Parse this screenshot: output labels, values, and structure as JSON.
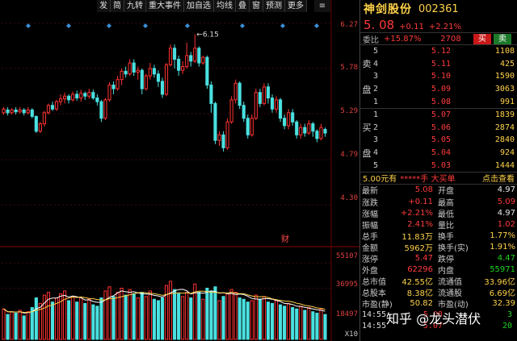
{
  "toolbar": {
    "items": [
      "发",
      "简",
      "九转",
      "重大事件",
      "加自选",
      "均线",
      "叠",
      "窗",
      "预测",
      "更多"
    ],
    "icon_left": "gear-icon",
    "menu_label": "≡"
  },
  "chart": {
    "price_labels": [
      "6.27",
      "5.78",
      "5.29",
      "4.79",
      "4.30"
    ],
    "peak_label": "6.15",
    "peak_marker": "←",
    "finance_badge": "财",
    "volume_labels": [
      "55107",
      "36995",
      "18497"
    ],
    "volume_unit": "X10"
  },
  "chart_data": {
    "type": "candlestick",
    "price_axis_ticks": [
      6.27,
      5.78,
      5.29,
      4.79,
      4.3
    ],
    "price_range": [
      3.9,
      6.4
    ],
    "volume_axis_ticks": [
      55107,
      36995,
      18497
    ],
    "volume_range": [
      0,
      60000
    ],
    "annotation_high": 6.15,
    "candles": [
      [
        5.3,
        5.34,
        5.28,
        5.36
      ],
      [
        5.33,
        5.3,
        5.27,
        5.36
      ],
      [
        5.3,
        5.33,
        5.28,
        5.35
      ],
      [
        5.33,
        5.31,
        5.28,
        5.36
      ],
      [
        5.31,
        5.33,
        5.29,
        5.36
      ],
      [
        5.33,
        5.3,
        5.27,
        5.35
      ],
      [
        5.3,
        5.33,
        5.28,
        5.36
      ],
      [
        5.33,
        5.26,
        5.24,
        5.35
      ],
      [
        5.26,
        5.1,
        5.08,
        5.27
      ],
      [
        5.1,
        5.18,
        5.08,
        5.2
      ],
      [
        5.18,
        5.3,
        5.15,
        5.32
      ],
      [
        5.3,
        5.38,
        5.28,
        5.4
      ],
      [
        5.38,
        5.34,
        5.32,
        5.42
      ],
      [
        5.34,
        5.42,
        5.32,
        5.44
      ],
      [
        5.42,
        5.45,
        5.38,
        5.5
      ],
      [
        5.45,
        5.48,
        5.4,
        5.52
      ],
      [
        5.48,
        5.44,
        5.4,
        5.5
      ],
      [
        5.44,
        5.5,
        5.42,
        5.53
      ],
      [
        5.5,
        5.46,
        5.43,
        5.54
      ],
      [
        5.46,
        5.51,
        5.42,
        5.55
      ],
      [
        5.51,
        5.48,
        5.44,
        5.53
      ],
      [
        5.48,
        5.52,
        5.45,
        5.56
      ],
      [
        5.52,
        5.46,
        5.44,
        5.55
      ],
      [
        5.46,
        5.42,
        5.38,
        5.5
      ],
      [
        5.42,
        5.24,
        5.2,
        5.44
      ],
      [
        5.24,
        5.44,
        5.22,
        5.46
      ],
      [
        5.44,
        5.6,
        5.42,
        5.63
      ],
      [
        5.6,
        5.56,
        5.5,
        5.64
      ],
      [
        5.56,
        5.66,
        5.54,
        5.7
      ],
      [
        5.66,
        5.75,
        5.6,
        5.78
      ],
      [
        5.75,
        5.72,
        5.68,
        5.8
      ],
      [
        5.72,
        5.84,
        5.7,
        5.88
      ],
      [
        5.84,
        5.74,
        5.7,
        5.88
      ],
      [
        5.74,
        5.76,
        5.66,
        5.8
      ],
      [
        5.76,
        5.56,
        5.5,
        5.78
      ],
      [
        5.56,
        5.7,
        5.54,
        5.72
      ],
      [
        5.7,
        5.78,
        5.66,
        5.84
      ],
      [
        5.78,
        5.72,
        5.68,
        5.82
      ],
      [
        5.72,
        5.64,
        5.58,
        5.76
      ],
      [
        5.64,
        5.5,
        5.46,
        5.68
      ],
      [
        5.5,
        5.82,
        5.48,
        5.84
      ],
      [
        5.82,
        6.0,
        5.8,
        6.04
      ],
      [
        6.0,
        5.88,
        5.78,
        6.04
      ],
      [
        5.88,
        5.76,
        5.7,
        5.92
      ],
      [
        5.76,
        5.8,
        5.72,
        5.86
      ],
      [
        5.8,
        5.92,
        5.78,
        6.06
      ],
      [
        5.92,
        5.86,
        5.8,
        5.96
      ],
      [
        5.86,
        6.0,
        5.84,
        6.15
      ],
      [
        6.0,
        5.84,
        5.8,
        6.02
      ],
      [
        5.84,
        5.9,
        5.82,
        5.92
      ],
      [
        5.9,
        5.6,
        5.56,
        5.92
      ],
      [
        5.6,
        5.4,
        5.3,
        5.64
      ],
      [
        5.4,
        5.0,
        4.96,
        5.42
      ],
      [
        5.0,
        5.06,
        4.94,
        5.1
      ],
      [
        5.06,
        4.92,
        4.88,
        5.1
      ],
      [
        4.92,
        5.2,
        4.9,
        5.24
      ],
      [
        5.2,
        5.44,
        5.18,
        5.48
      ],
      [
        5.44,
        5.62,
        5.4,
        5.66
      ],
      [
        5.62,
        5.38,
        5.34,
        5.64
      ],
      [
        5.38,
        5.24,
        5.2,
        5.42
      ],
      [
        5.24,
        5.06,
        5.02,
        5.28
      ],
      [
        5.06,
        5.24,
        5.04,
        5.28
      ],
      [
        5.24,
        5.52,
        5.22,
        5.56
      ],
      [
        5.52,
        5.4,
        5.36,
        5.56
      ],
      [
        5.4,
        5.58,
        5.38,
        5.62
      ],
      [
        5.58,
        5.46,
        5.4,
        5.62
      ],
      [
        5.46,
        5.34,
        5.3,
        5.5
      ],
      [
        5.34,
        5.44,
        5.3,
        5.48
      ],
      [
        5.44,
        5.24,
        5.2,
        5.46
      ],
      [
        5.24,
        5.16,
        5.12,
        5.28
      ],
      [
        5.16,
        5.3,
        5.12,
        5.34
      ],
      [
        5.3,
        5.2,
        5.16,
        5.34
      ],
      [
        5.2,
        5.06,
        5.02,
        5.22
      ],
      [
        5.06,
        5.14,
        5.02,
        5.18
      ],
      [
        5.14,
        5.08,
        5.04,
        5.18
      ],
      [
        5.08,
        5.18,
        5.06,
        5.22
      ],
      [
        5.18,
        5.1,
        5.04,
        5.2
      ],
      [
        5.1,
        5.02,
        4.98,
        5.12
      ],
      [
        5.02,
        5.14,
        5.0,
        5.18
      ],
      [
        5.12,
        5.08,
        5.04,
        5.14
      ]
    ],
    "volumes": [
      22000,
      18000,
      20000,
      19000,
      21000,
      17000,
      20000,
      23000,
      30000,
      26000,
      32000,
      34000,
      27000,
      30000,
      33000,
      35000,
      28000,
      31000,
      27000,
      30000,
      26000,
      29000,
      25000,
      24000,
      30000,
      35000,
      38000,
      31000,
      34000,
      37000,
      32000,
      36000,
      33000,
      30000,
      34000,
      31000,
      35000,
      29000,
      28000,
      30000,
      39000,
      42000,
      36000,
      33000,
      31000,
      34000,
      30000,
      40000,
      34000,
      29000,
      37000,
      35000,
      38000,
      28000,
      31000,
      33000,
      36000,
      34000,
      30000,
      29000,
      27000,
      28000,
      32000,
      29000,
      31000,
      27000,
      26000,
      28000,
      25000,
      24000,
      26000,
      23000,
      22000,
      24000,
      21000,
      23000,
      20000,
      19000,
      22000,
      18000
    ]
  },
  "panel": {
    "stock_name": "神剑股份",
    "stock_code": "002361",
    "price": "5. 08",
    "change": "+0.11",
    "change_pct": "+2.21%",
    "ratio_label": "委比",
    "ratio_value": "+15.87%",
    "ratio_num": "2708",
    "buy_btn": "买",
    "sell_btn": "卖",
    "sell_side_label": [
      "卖",
      "盘"
    ],
    "buy_side_label": [
      "买",
      "盘"
    ],
    "asks": [
      {
        "lvl": "5",
        "px": "5.12",
        "qty": "1108"
      },
      {
        "lvl": "4",
        "px": "5.11",
        "qty": "425"
      },
      {
        "lvl": "3",
        "px": "5.10",
        "qty": "1590"
      },
      {
        "lvl": "2",
        "px": "5.09",
        "qty": "3063"
      },
      {
        "lvl": "1",
        "px": "5.08",
        "qty": "991"
      }
    ],
    "bids": [
      {
        "lvl": "1",
        "px": "5.07",
        "qty": "1839"
      },
      {
        "lvl": "2",
        "px": "5.06",
        "qty": "2874"
      },
      {
        "lvl": "3",
        "px": "5.05",
        "qty": "2840"
      },
      {
        "lvl": "4",
        "px": "5.04",
        "qty": "924"
      },
      {
        "lvl": "5",
        "px": "5.03",
        "qty": "1444"
      }
    ],
    "notice_price": "5.00元有",
    "notice_mid": "*****手 大买单",
    "notice_link": "点击查看",
    "stats": [
      {
        "k": "最新",
        "v": "5.08",
        "vc": "red",
        "k2": "开盘",
        "v2": "4.97",
        "v2c": "white"
      },
      {
        "k": "涨跌",
        "v": "+0.11",
        "vc": "red",
        "k2": "最高",
        "v2": "5.09",
        "v2c": "red"
      },
      {
        "k": "涨幅",
        "v": "+2.21%",
        "vc": "red",
        "k2": "最低",
        "v2": "4.97",
        "v2c": "white"
      },
      {
        "k": "振幅",
        "v": "2.41%",
        "vc": "red",
        "k2": "量比",
        "v2": "1.02",
        "v2c": "red"
      },
      {
        "k": "总手",
        "v": "11.83万",
        "vc": "yellow",
        "k2": "换手",
        "v2": "1.77%",
        "v2c": "yellow"
      },
      {
        "k": "金额",
        "v": "5962万",
        "vc": "yellow",
        "k2": "换手(实)",
        "v2": "1.91%",
        "v2c": "yellow"
      },
      {
        "k": "涨停",
        "v": "5.47",
        "vc": "red",
        "k2": "跌停",
        "v2": "4.47",
        "v2c": "green"
      },
      {
        "k": "外盘",
        "v": "62296",
        "vc": "red",
        "k2": "内盘",
        "v2": "55971",
        "v2c": "green"
      },
      {
        "k": "总市值",
        "v": "42.55亿",
        "vc": "yellow",
        "k2": "流通值",
        "v2": "33.96亿",
        "v2c": "yellow"
      },
      {
        "k": "总股本",
        "v": "8.38亿",
        "vc": "yellow",
        "k2": "流通股",
        "v2": "6.69亿",
        "v2c": "yellow"
      },
      {
        "k": "市盈(静)",
        "v": "50.82",
        "vc": "yellow",
        "k2": "市盈(动)",
        "v2": "32.39",
        "v2c": "yellow"
      }
    ],
    "ticks": [
      {
        "t": "14:55",
        "p": "5.08",
        "q": "3"
      },
      {
        "t": "14:55",
        "p": "5.07",
        "q": "20"
      }
    ]
  },
  "watermark": "知乎 @龙头潜伏"
}
